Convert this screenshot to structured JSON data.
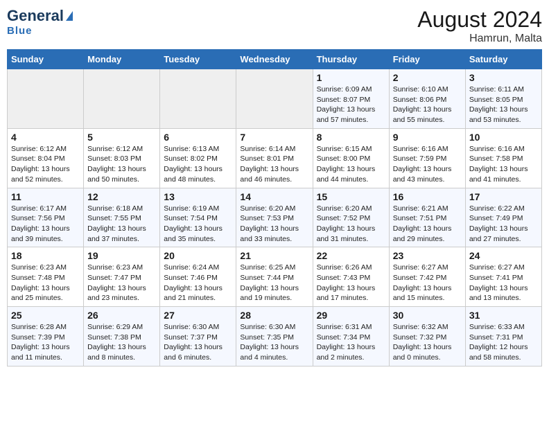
{
  "header": {
    "logo_general": "General",
    "logo_blue": "Blue",
    "month_title": "August 2024",
    "location": "Hamrun, Malta"
  },
  "weekdays": [
    "Sunday",
    "Monday",
    "Tuesday",
    "Wednesday",
    "Thursday",
    "Friday",
    "Saturday"
  ],
  "weeks": [
    [
      {
        "day": "",
        "empty": true
      },
      {
        "day": "",
        "empty": true
      },
      {
        "day": "",
        "empty": true
      },
      {
        "day": "",
        "empty": true
      },
      {
        "day": "1",
        "sunrise": "6:09 AM",
        "sunset": "8:07 PM",
        "daylight": "13 hours and 57 minutes."
      },
      {
        "day": "2",
        "sunrise": "6:10 AM",
        "sunset": "8:06 PM",
        "daylight": "13 hours and 55 minutes."
      },
      {
        "day": "3",
        "sunrise": "6:11 AM",
        "sunset": "8:05 PM",
        "daylight": "13 hours and 53 minutes."
      }
    ],
    [
      {
        "day": "4",
        "sunrise": "6:12 AM",
        "sunset": "8:04 PM",
        "daylight": "13 hours and 52 minutes."
      },
      {
        "day": "5",
        "sunrise": "6:12 AM",
        "sunset": "8:03 PM",
        "daylight": "13 hours and 50 minutes."
      },
      {
        "day": "6",
        "sunrise": "6:13 AM",
        "sunset": "8:02 PM",
        "daylight": "13 hours and 48 minutes."
      },
      {
        "day": "7",
        "sunrise": "6:14 AM",
        "sunset": "8:01 PM",
        "daylight": "13 hours and 46 minutes."
      },
      {
        "day": "8",
        "sunrise": "6:15 AM",
        "sunset": "8:00 PM",
        "daylight": "13 hours and 44 minutes."
      },
      {
        "day": "9",
        "sunrise": "6:16 AM",
        "sunset": "7:59 PM",
        "daylight": "13 hours and 43 minutes."
      },
      {
        "day": "10",
        "sunrise": "6:16 AM",
        "sunset": "7:58 PM",
        "daylight": "13 hours and 41 minutes."
      }
    ],
    [
      {
        "day": "11",
        "sunrise": "6:17 AM",
        "sunset": "7:56 PM",
        "daylight": "13 hours and 39 minutes."
      },
      {
        "day": "12",
        "sunrise": "6:18 AM",
        "sunset": "7:55 PM",
        "daylight": "13 hours and 37 minutes."
      },
      {
        "day": "13",
        "sunrise": "6:19 AM",
        "sunset": "7:54 PM",
        "daylight": "13 hours and 35 minutes."
      },
      {
        "day": "14",
        "sunrise": "6:20 AM",
        "sunset": "7:53 PM",
        "daylight": "13 hours and 33 minutes."
      },
      {
        "day": "15",
        "sunrise": "6:20 AM",
        "sunset": "7:52 PM",
        "daylight": "13 hours and 31 minutes."
      },
      {
        "day": "16",
        "sunrise": "6:21 AM",
        "sunset": "7:51 PM",
        "daylight": "13 hours and 29 minutes."
      },
      {
        "day": "17",
        "sunrise": "6:22 AM",
        "sunset": "7:49 PM",
        "daylight": "13 hours and 27 minutes."
      }
    ],
    [
      {
        "day": "18",
        "sunrise": "6:23 AM",
        "sunset": "7:48 PM",
        "daylight": "13 hours and 25 minutes."
      },
      {
        "day": "19",
        "sunrise": "6:23 AM",
        "sunset": "7:47 PM",
        "daylight": "13 hours and 23 minutes."
      },
      {
        "day": "20",
        "sunrise": "6:24 AM",
        "sunset": "7:46 PM",
        "daylight": "13 hours and 21 minutes."
      },
      {
        "day": "21",
        "sunrise": "6:25 AM",
        "sunset": "7:44 PM",
        "daylight": "13 hours and 19 minutes."
      },
      {
        "day": "22",
        "sunrise": "6:26 AM",
        "sunset": "7:43 PM",
        "daylight": "13 hours and 17 minutes."
      },
      {
        "day": "23",
        "sunrise": "6:27 AM",
        "sunset": "7:42 PM",
        "daylight": "13 hours and 15 minutes."
      },
      {
        "day": "24",
        "sunrise": "6:27 AM",
        "sunset": "7:41 PM",
        "daylight": "13 hours and 13 minutes."
      }
    ],
    [
      {
        "day": "25",
        "sunrise": "6:28 AM",
        "sunset": "7:39 PM",
        "daylight": "13 hours and 11 minutes."
      },
      {
        "day": "26",
        "sunrise": "6:29 AM",
        "sunset": "7:38 PM",
        "daylight": "13 hours and 8 minutes."
      },
      {
        "day": "27",
        "sunrise": "6:30 AM",
        "sunset": "7:37 PM",
        "daylight": "13 hours and 6 minutes."
      },
      {
        "day": "28",
        "sunrise": "6:30 AM",
        "sunset": "7:35 PM",
        "daylight": "13 hours and 4 minutes."
      },
      {
        "day": "29",
        "sunrise": "6:31 AM",
        "sunset": "7:34 PM",
        "daylight": "13 hours and 2 minutes."
      },
      {
        "day": "30",
        "sunrise": "6:32 AM",
        "sunset": "7:32 PM",
        "daylight": "13 hours and 0 minutes."
      },
      {
        "day": "31",
        "sunrise": "6:33 AM",
        "sunset": "7:31 PM",
        "daylight": "12 hours and 58 minutes."
      }
    ]
  ],
  "labels": {
    "sunrise": "Sunrise:",
    "sunset": "Sunset:",
    "daylight": "Daylight:"
  }
}
